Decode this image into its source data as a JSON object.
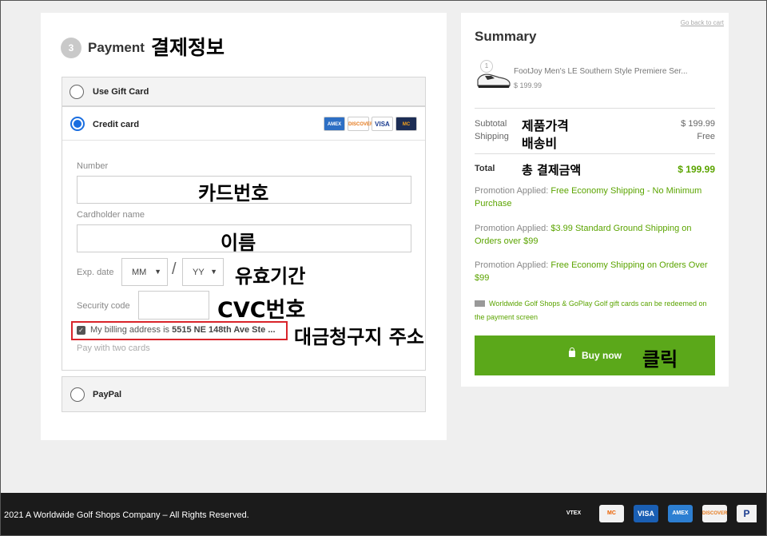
{
  "payment": {
    "step_number": "3",
    "title": "Payment",
    "title_note": "결제정보",
    "options": {
      "gift_card": "Use Gift Card",
      "credit_card": "Credit card",
      "paypal": "PayPal"
    },
    "card_brands": [
      "AMEX",
      "DISCOVER",
      "VISA",
      "MC"
    ],
    "fields": {
      "number_label": "Number",
      "number_note": "카드번호",
      "holder_label": "Cardholder name",
      "holder_note": "이름",
      "exp_label": "Exp. date",
      "exp_month": "MM",
      "exp_year": "YY",
      "exp_separator": "/",
      "exp_note": "유효기간",
      "security_label": "Security code",
      "security_note": "CVC번호"
    },
    "billing": {
      "checked": true,
      "text": "My billing address is ",
      "address": "5515 NE 148th Ave Ste ...",
      "note": "대금청구지 주소"
    },
    "two_cards": "Pay with two cards"
  },
  "summary": {
    "title": "Summary",
    "back_link": "Go back to cart",
    "product": {
      "qty": "1",
      "name": "FootJoy Men's LE Southern Style Premiere Ser...",
      "price": "$ 199.99",
      "icon": "golf-shoe-icon"
    },
    "subtotal_label": "Subtotal",
    "subtotal_value": "$ 199.99",
    "subtotal_note": "제품가격",
    "shipping_label": "Shipping",
    "shipping_value": "Free",
    "shipping_note": "배송비",
    "total_label": "Total",
    "total_value": "$ 199.99",
    "total_note": "총 결제금액",
    "promotions": [
      {
        "prefix": "Promotion Applied: ",
        "text": "Free Economy Shipping - No Minimum Purchase"
      },
      {
        "prefix": "Promotion Applied: ",
        "text": "$3.99 Standard Ground Shipping on Orders over $99"
      },
      {
        "prefix": "Promotion Applied: ",
        "text": "Free Economy Shipping on Orders Over $99"
      }
    ],
    "gift_note": "Worldwide Golf Shops & GoPlay Golf gift cards can be redeemed on the payment screen",
    "buy_label": "Buy now",
    "buy_note": "클릭"
  },
  "footer": {
    "copyright": "2021 A Worldwide Golf Shops Company – All Rights Reserved.",
    "logos": [
      "VTEX",
      "MC",
      "VISA",
      "AMEX",
      "DISCOVER",
      "P"
    ]
  },
  "colors": {
    "accent_green": "#5ba81a",
    "price_green": "#5ba400",
    "radio_blue": "#1a6ee0",
    "highlight_red": "#d9242a"
  }
}
